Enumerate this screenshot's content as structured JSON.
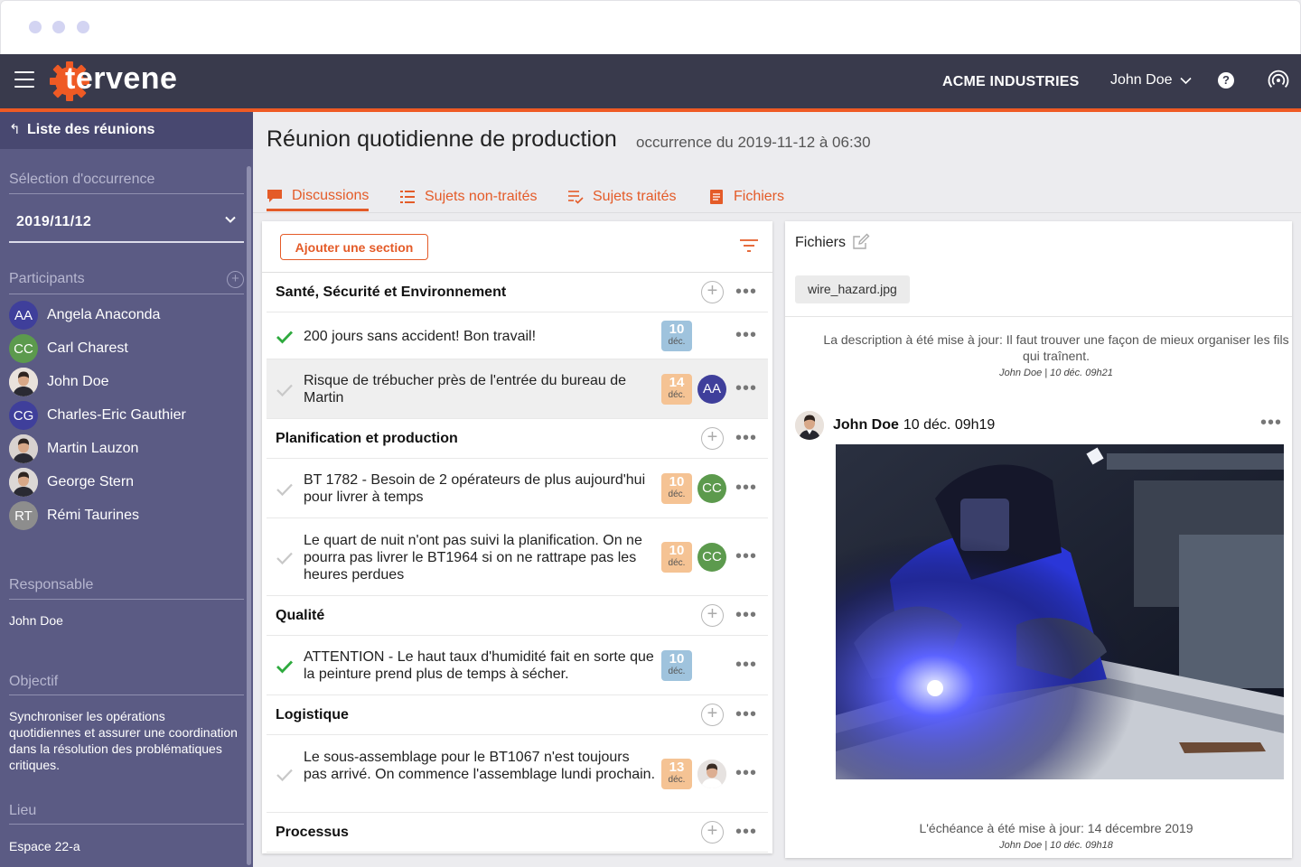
{
  "app": {
    "brand": "tervene",
    "company": "ACME INDUSTRIES",
    "user_name": "John Doe",
    "help_label": "?"
  },
  "sidebar": {
    "back_label": "Liste des réunions",
    "occurrence_title": "Sélection d'occurrence",
    "occurrence_value": "2019/11/12",
    "participants_title": "Participants",
    "add_participant": "+",
    "participants": [
      {
        "initials": "AA",
        "name": "Angela Anaconda",
        "color": "#3f3f9b",
        "photo": false
      },
      {
        "initials": "CC",
        "name": "Carl Charest",
        "color": "#5c9a4d",
        "photo": false
      },
      {
        "initials": "",
        "name": "John Doe",
        "color": "#e9e2dc",
        "photo": true
      },
      {
        "initials": "CG",
        "name": "Charles-Eric Gauthier",
        "color": "#3f3f9b",
        "photo": false
      },
      {
        "initials": "",
        "name": "Martin Lauzon",
        "color": "#d8d2cf",
        "photo": true
      },
      {
        "initials": "",
        "name": "George Stern",
        "color": "#dcd8d6",
        "photo": true
      },
      {
        "initials": "RT",
        "name": "Rémi Taurines",
        "color": "#8d8d8d",
        "photo": false
      }
    ],
    "owner_title": "Responsable",
    "owner_value": "John Doe",
    "objective_title": "Objectif",
    "objective_value": "Synchroniser les opérations quotidiennes et assurer une coordination dans la résolution des problématiques critiques.",
    "location_title": "Lieu",
    "location_value": "Espace 22-a"
  },
  "main": {
    "title": "Réunion quotidienne de production",
    "subtitle": "occurrence du 2019-11-12 à 06:30",
    "tabs": [
      {
        "label": "Discussions",
        "icon": "chat-icon",
        "active": true
      },
      {
        "label": "Sujets non-traités",
        "icon": "list-icon",
        "active": false
      },
      {
        "label": "Sujets traités",
        "icon": "checklist-icon",
        "active": false
      },
      {
        "label": "Fichiers",
        "icon": "document-icon",
        "active": false
      }
    ]
  },
  "discussions": {
    "add_section_label": "Ajouter une section",
    "sections": [
      {
        "title": "Santé, Sécurité et Environnement",
        "items": [
          {
            "text": "200 jours sans accident! Bon travail!",
            "done": true,
            "day": "10",
            "month": "déc.",
            "badge_color": "blue",
            "assignee": ""
          },
          {
            "text": "Risque de trébucher près de l'entrée du bureau de Martin",
            "done": false,
            "day": "14",
            "month": "déc.",
            "badge_color": "orange",
            "assignee": "AA"
          }
        ]
      },
      {
        "title": "Planification et production",
        "items": [
          {
            "text": "BT 1782 - Besoin de 2 opérateurs de plus aujourd'hui pour livrer à temps",
            "done": false,
            "day": "10",
            "month": "déc.",
            "badge_color": "orange",
            "assignee": "CC"
          },
          {
            "text": "Le quart de nuit n'ont pas suivi la planification. On ne pourra pas livrer le BT1964 si on ne rattrape pas les heures perdues",
            "done": false,
            "day": "10",
            "month": "déc.",
            "badge_color": "orange",
            "assignee": "CC"
          }
        ]
      },
      {
        "title": "Qualité",
        "items": [
          {
            "text": "ATTENTION - Le haut taux d'humidité fait en sorte que la peinture prend plus de temps à sécher.",
            "done": true,
            "day": "10",
            "month": "déc.",
            "badge_color": "blue",
            "assignee": ""
          }
        ]
      },
      {
        "title": "Logistique",
        "items": [
          {
            "text": "Le sous-assemblage pour le BT1067 n'est toujours pas arrivé. On commence l'assemblage lundi prochain.",
            "done": false,
            "day": "13",
            "month": "déc.",
            "badge_color": "orange",
            "assignee": "photo"
          }
        ]
      },
      {
        "title": "Processus",
        "items": []
      }
    ]
  },
  "files": {
    "title": "Fichiers",
    "file_name": "wire_hazard.jpg",
    "activity_1": "La description à été mise à jour: Il faut trouver une façon de mieux organiser les fils qui traînent.",
    "activity_1_meta": "John Doe | 10 déc. 09h21",
    "post_author": "John Doe",
    "post_time": "10 déc. 09h19",
    "activity_2": "L'échéance à été mise à jour: 14 décembre 2019",
    "activity_2_meta": "John Doe | 10 déc. 09h18"
  },
  "colors": {
    "accent": "#e45b28",
    "appbar": "#393a4c",
    "sidebar": "#5b5b84",
    "check_done": "#2eaa3e",
    "check_pending": "#c8c8c8"
  }
}
